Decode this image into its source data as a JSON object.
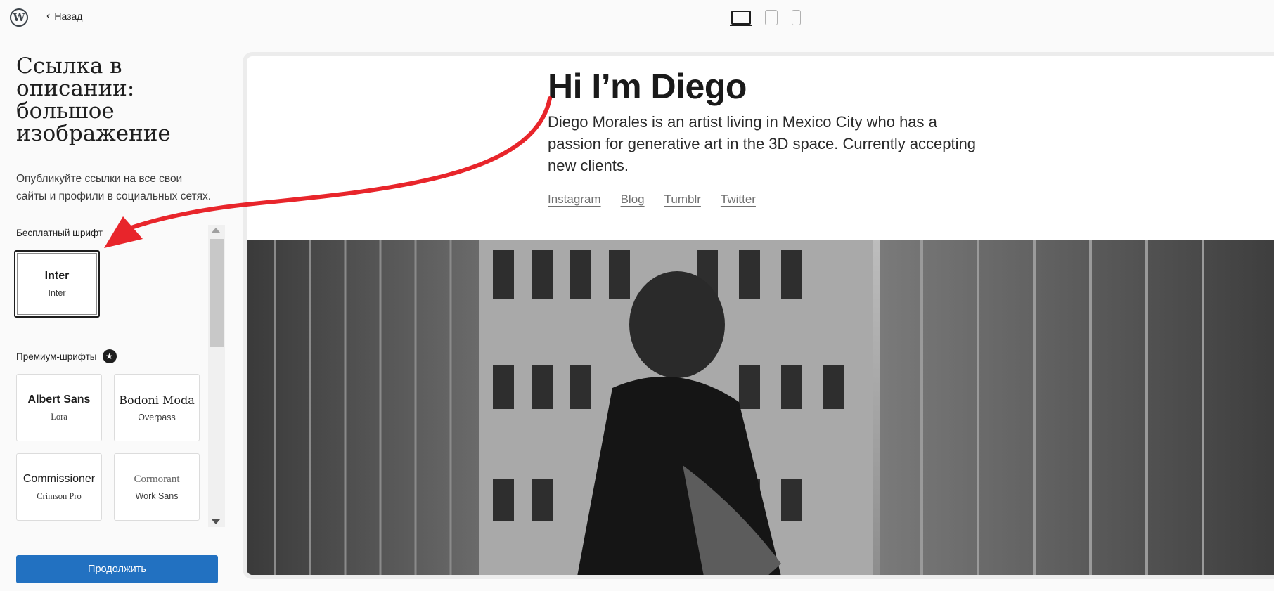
{
  "topbar": {
    "logo_icon": "wordpress-logo-icon",
    "back_label": "Назад",
    "devices": [
      "desktop-icon",
      "tablet-icon",
      "phone-icon"
    ]
  },
  "sidebar": {
    "title": "Ссылка в описании: большое изображение",
    "description": "Опубликуйте ссылки на все свои сайты и профили в социальных сетях.",
    "free_label": "Бесплатный шрифт",
    "premium_label": "Премиум-шрифты",
    "free_fonts": [
      {
        "heading": "Inter",
        "body": "Inter"
      }
    ],
    "premium_fonts": [
      {
        "heading": "Albert Sans",
        "body": "Lora"
      },
      {
        "heading": "Bodoni Moda",
        "body": "Overpass"
      },
      {
        "heading": "Commissioner",
        "body": "Crimson Pro"
      },
      {
        "heading": "Cormorant",
        "body": "Work Sans"
      }
    ],
    "continue_label": "Продолжить"
  },
  "preview": {
    "title": "Hi I’m Diego",
    "description": "Diego Morales is an artist living in Mexico City who has a passion for generative art in the 3D space. Currently accepting new clients.",
    "links": [
      "Instagram",
      "Blog",
      "Tumblr",
      "Twitter"
    ]
  },
  "colors": {
    "accent": "#2271c1",
    "arrow": "#e8252b"
  }
}
